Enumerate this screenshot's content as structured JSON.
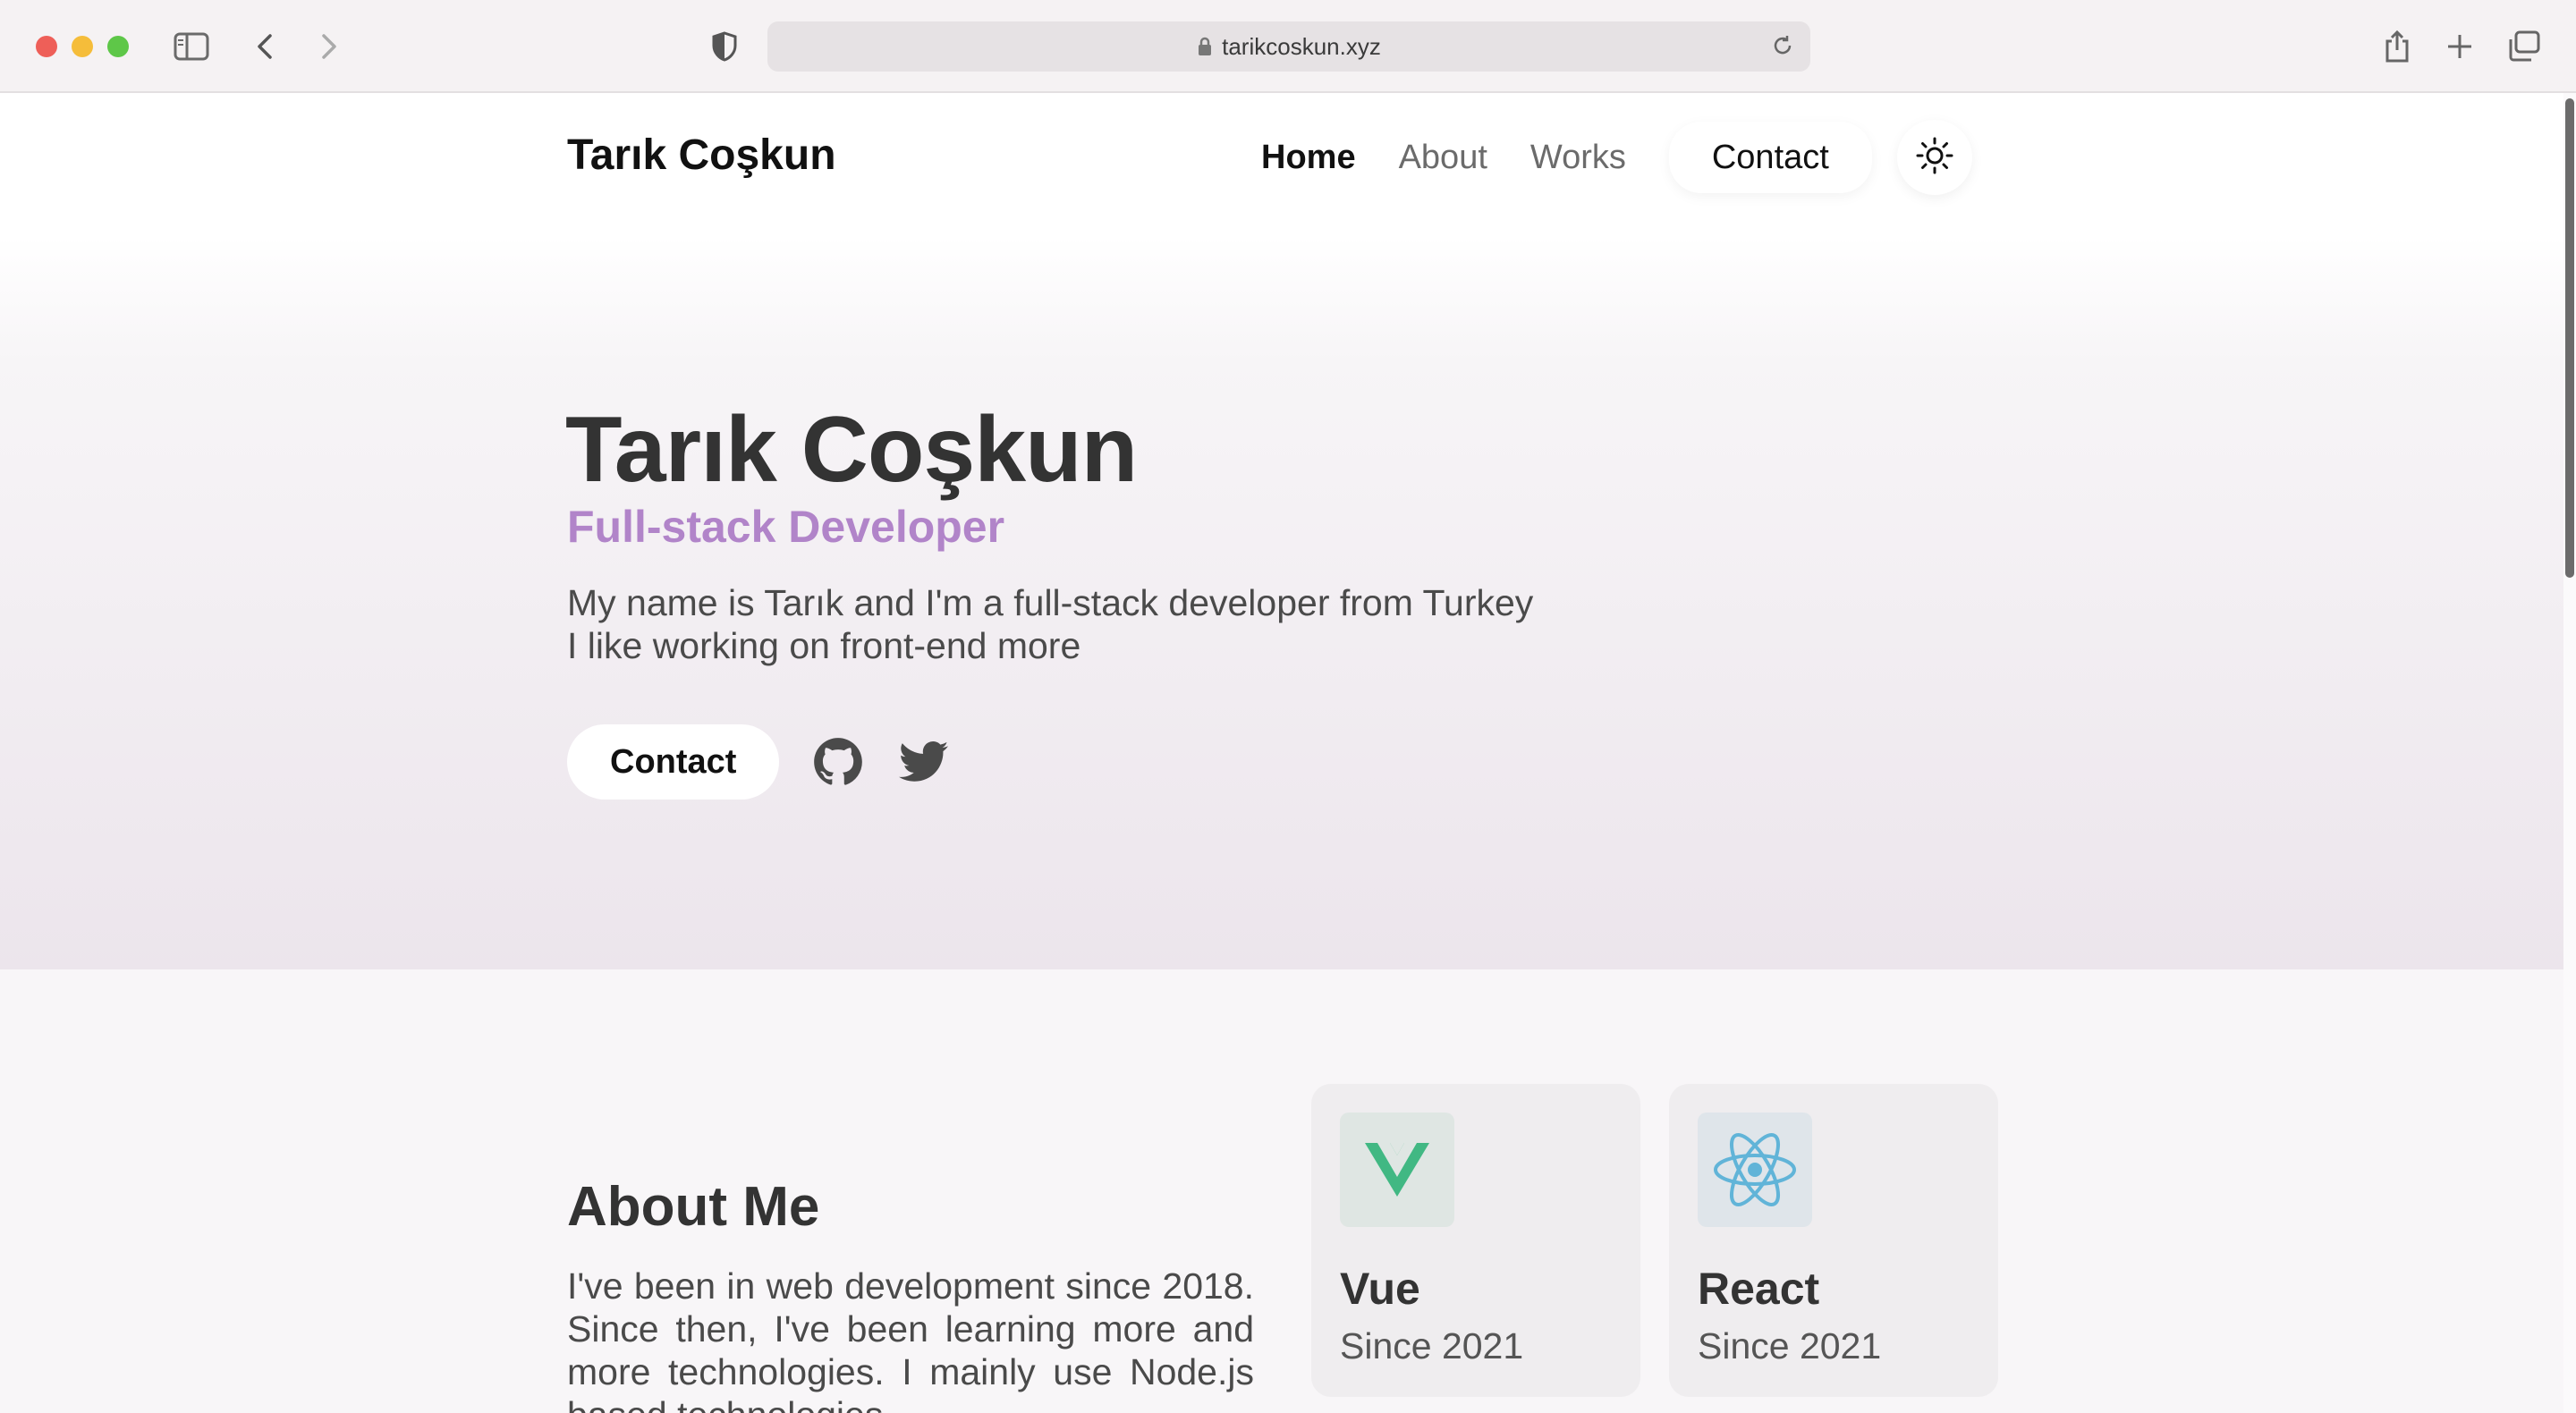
{
  "browser": {
    "url": "tarikcoskun.xyz"
  },
  "nav": {
    "brand": "Tarık Coşkun",
    "links": [
      "Home",
      "About",
      "Works"
    ],
    "contact": "Contact"
  },
  "hero": {
    "title": "Tarık Coşkun",
    "subtitle": "Full-stack Developer",
    "description_line1": "My name is Tarık and I'm a full-stack developer from Turkey",
    "description_line2": "I like working on front-end more",
    "contact_button": "Contact",
    "socials": [
      "github-icon",
      "twitter-icon"
    ]
  },
  "about": {
    "title": "About Me",
    "text": "I've been in web development since 2018. Since then, I've been learning more and more technologies. I mainly use Node.js based technologies."
  },
  "tech": [
    {
      "name": "Vue",
      "since": "Since 2021",
      "color": "#41b883"
    },
    {
      "name": "React",
      "since": "Since 2021",
      "color": "#61b4d8"
    }
  ],
  "colors": {
    "accent": "#b184c9"
  }
}
